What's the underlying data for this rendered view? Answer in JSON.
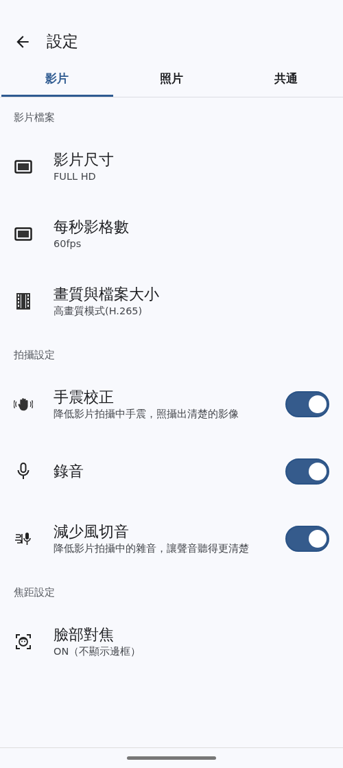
{
  "header": {
    "title": "設定"
  },
  "tabs": [
    {
      "label": "影片",
      "selected": true
    },
    {
      "label": "照片",
      "selected": false
    },
    {
      "label": "共通",
      "selected": false
    }
  ],
  "sections": [
    {
      "title": "影片檔案",
      "items": [
        {
          "kind": "nav",
          "title": "影片尺寸",
          "subtitle": "FULL HD"
        },
        {
          "kind": "nav",
          "title": "每秒影格數",
          "subtitle": "60fps"
        },
        {
          "kind": "nav",
          "title": "畫質與檔案大小",
          "subtitle": "高畫質模式(H.265)"
        }
      ]
    },
    {
      "title": "拍攝設定",
      "items": [
        {
          "kind": "toggle",
          "title": "手震校正",
          "subtitle": "降低影片拍攝中手震，照攝出清楚的影像",
          "on": true
        },
        {
          "kind": "toggle",
          "title": "錄音",
          "on": true
        },
        {
          "kind": "toggle",
          "title": "減少風切音",
          "subtitle": "降低影片拍攝中的雜音，讓聲音聽得更清楚",
          "on": true
        }
      ]
    },
    {
      "title": "焦距設定",
      "items": [
        {
          "kind": "nav",
          "title": "臉部對焦",
          "subtitle": "ON（不顯示邊框）"
        }
      ]
    }
  ]
}
